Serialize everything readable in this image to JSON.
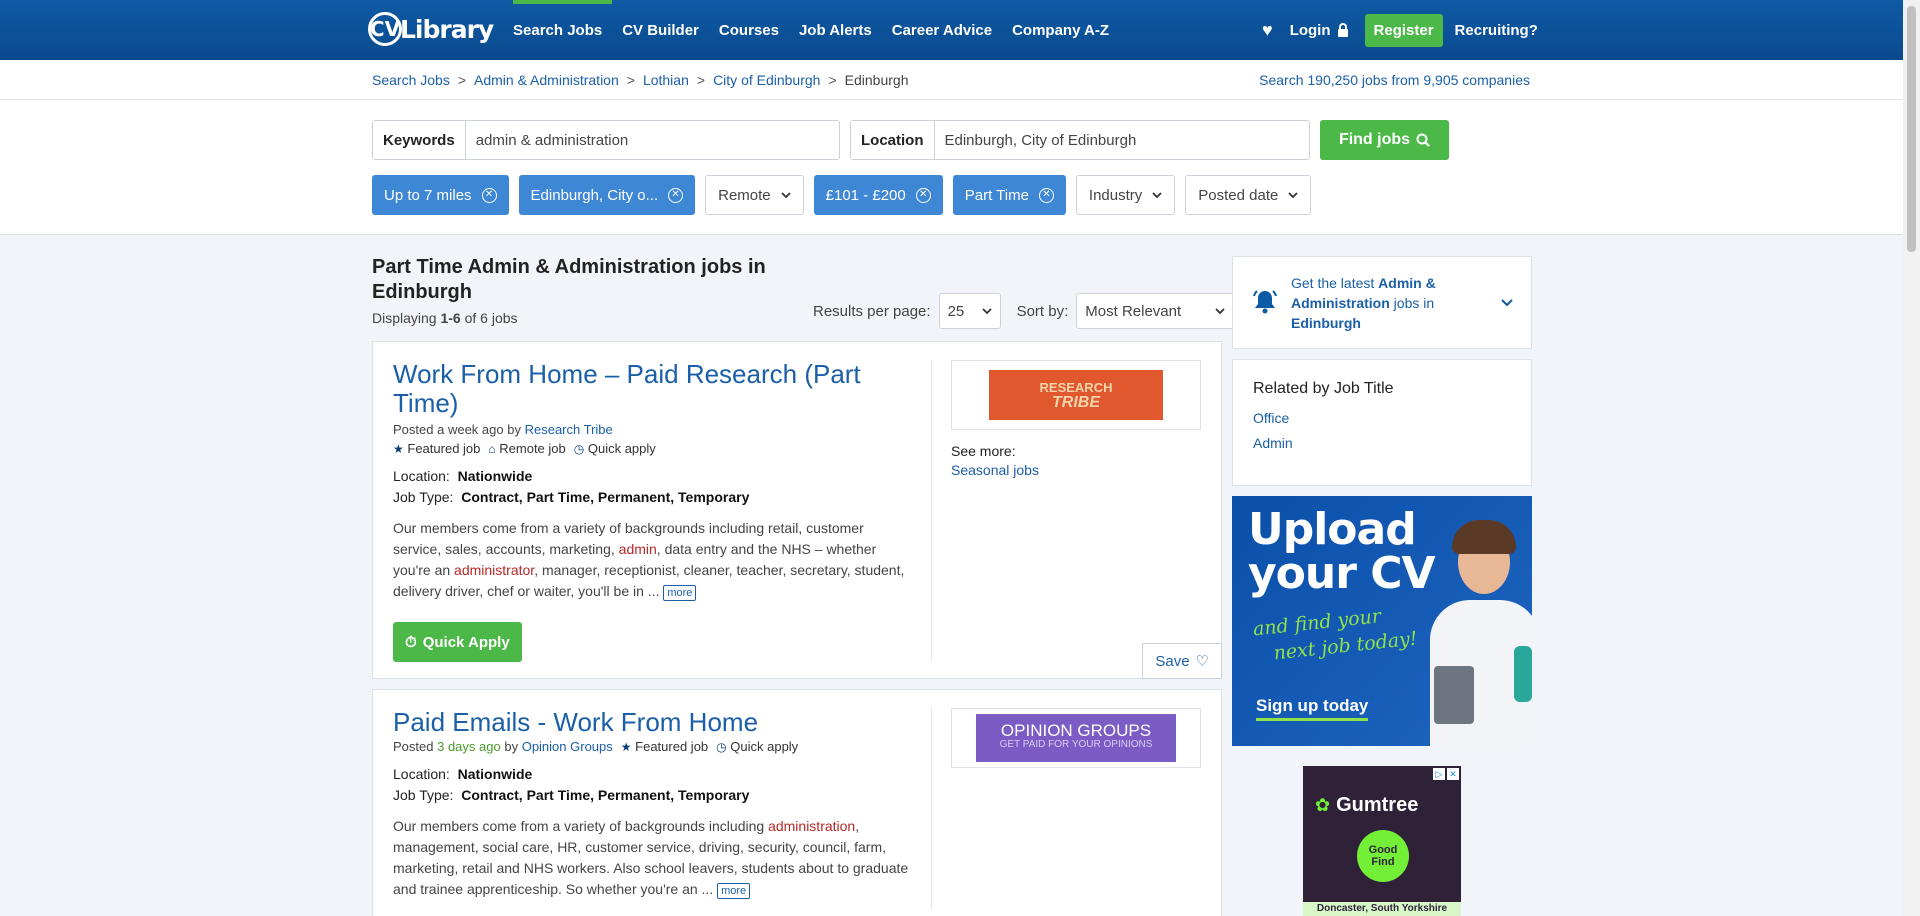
{
  "header": {
    "logo_text": "CV Library",
    "nav": [
      "Search Jobs",
      "CV Builder",
      "Courses",
      "Job Alerts",
      "Career Advice",
      "Company A-Z"
    ],
    "login": "Login",
    "register": "Register",
    "recruiting": "Recruiting?"
  },
  "breadcrumb": {
    "items": [
      "Search Jobs",
      "Admin & Administration",
      "Lothian",
      "City of Edinburgh",
      "Edinburgh"
    ],
    "counts_prefix": "Search",
    "jobs_count": "190,250 jobs",
    "from_text": "from",
    "companies_count": "9,905 companies"
  },
  "search": {
    "keywords_label": "Keywords",
    "keywords_value": "admin & administration",
    "location_label": "Location",
    "location_value": "Edinburgh, City of Edinburgh",
    "find_label": "Find jobs"
  },
  "filters": [
    {
      "label": "Up to 7 miles",
      "active": true
    },
    {
      "label": "Edinburgh, City o...",
      "active": true
    },
    {
      "label": "Remote",
      "active": false
    },
    {
      "label": "£101 - £200",
      "active": true
    },
    {
      "label": "Part Time",
      "active": true
    },
    {
      "label": "Industry",
      "active": false
    },
    {
      "label": "Posted date",
      "active": false
    }
  ],
  "results": {
    "title": "Part Time Admin & Administration jobs in Edinburgh",
    "displaying_prefix": "Displaying",
    "displaying_range": "1-6",
    "displaying_suffix": "of 6 jobs",
    "per_page_label": "Results per page:",
    "per_page_value": "25",
    "sort_label": "Sort by:",
    "sort_value": "Most Relevant"
  },
  "jobs": [
    {
      "title": "Work From Home – Paid Research (Part Time)",
      "posted_prefix": "Posted",
      "posted_when": "a week ago",
      "by": "by",
      "company": "Research Tribe",
      "tags": [
        "Featured job",
        "Remote job",
        "Quick apply"
      ],
      "location_label": "Location:",
      "location": "Nationwide",
      "type_label": "Job Type:",
      "type": "Contract, Part Time, Permanent, Temporary",
      "desc_a": "Our members come from a variety of backgrounds including retail, customer service, sales, accounts, marketing,",
      "desc_hl1": "admin",
      "desc_b": ", data entry and the NHS – whether you're an",
      "desc_hl2": "administrator",
      "desc_c": ", manager, receptionist, cleaner, teacher, secretary, student, delivery driver, chef or waiter, you'll be in ...",
      "more": "more",
      "quick_apply": "Quick Apply",
      "logo_line1": "RESEARCH",
      "logo_line2": "TRIBE",
      "see_more": "See more:",
      "see_more_link": "Seasonal jobs",
      "save": "Save"
    },
    {
      "title": "Paid Emails - Work From Home",
      "posted_prefix": "Posted",
      "posted_when": "3 days ago",
      "by": "by",
      "company": "Opinion Groups",
      "tags": [
        "Featured job",
        "Quick apply"
      ],
      "location_label": "Location:",
      "location": "Nationwide",
      "type_label": "Job Type:",
      "type": "Contract, Part Time, Permanent, Temporary",
      "desc_a": "Our members come from a variety of backgrounds including",
      "desc_hl1": "administration",
      "desc_b": ", management, social care, HR, customer service, driving, security, council, farm, marketing, retail and NHS workers. Also school leavers, students about to graduate and trainee apprenticeship. So whether you're an ...",
      "more": "more",
      "logo_line1": "OPINION GROUPS",
      "logo_line2": "GET PAID FOR YOUR OPINIONS"
    }
  ],
  "sidebar": {
    "alert_prefix": "Get the latest",
    "alert_bold1": "Admin & Administration",
    "alert_mid": "jobs in",
    "alert_bold2": "Edinburgh",
    "related_title": "Related by Job Title",
    "related": [
      "Office",
      "Admin"
    ],
    "ad_line1": "Upload",
    "ad_line2": "your CV",
    "ad_line3": "and find your",
    "ad_line4": "next job today!",
    "ad_cta": "Sign up today",
    "gum_brand": "Gumtree",
    "gum_badge": "Good Find",
    "gum_caption": "Doncaster, South Yorkshire"
  }
}
